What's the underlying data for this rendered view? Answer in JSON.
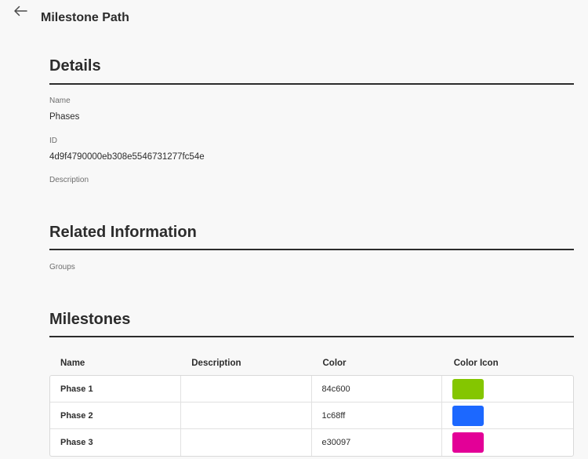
{
  "header": {
    "back_icon": "arrow-left-icon",
    "title": "Milestone Path"
  },
  "details": {
    "heading": "Details",
    "name_label": "Name",
    "name_value": "Phases",
    "id_label": "ID",
    "id_value": "4d9f4790000eb308e5546731277fc54e",
    "description_label": "Description",
    "description_value": ""
  },
  "related": {
    "heading": "Related Information",
    "groups_label": "Groups",
    "groups_value": ""
  },
  "milestones": {
    "heading": "Milestones",
    "columns": [
      "Name",
      "Description",
      "Color",
      "Color Icon"
    ],
    "rows": [
      {
        "name": "Phase 1",
        "description": "",
        "color": "84c600",
        "swatch": "#84c600"
      },
      {
        "name": "Phase 2",
        "description": "",
        "color": "1c68ff",
        "swatch": "#1c68ff"
      },
      {
        "name": "Phase 3",
        "description": "",
        "color": "e30097",
        "swatch": "#e30097"
      }
    ]
  }
}
